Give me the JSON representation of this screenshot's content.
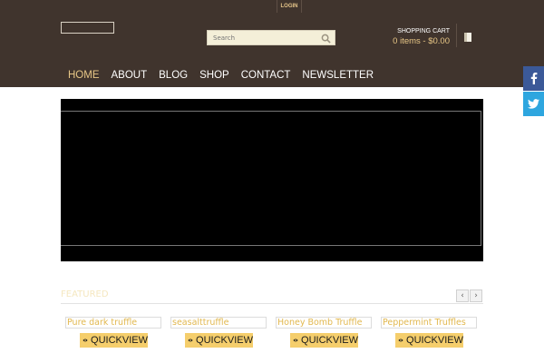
{
  "header": {
    "login": "LOGIN",
    "search": {
      "placeholder": "Search"
    },
    "cart": {
      "title": "SHOPPING CART",
      "summary": "0 items - $0.00"
    }
  },
  "nav": {
    "items": [
      {
        "label": "HOME",
        "active": true
      },
      {
        "label": "ABOUT"
      },
      {
        "label": "BLOG"
      },
      {
        "label": "SHOP"
      },
      {
        "label": "CONTACT"
      },
      {
        "label": "NEWSLETTER"
      }
    ]
  },
  "social": {
    "facebook_icon": "facebook-icon",
    "twitter_icon": "twitter-icon"
  },
  "featured": {
    "title": "FEATURED",
    "prev_label": "‹",
    "next_label": "›",
    "products": [
      {
        "name": "Pure dark truffle",
        "quickview": "QUICKVIEW"
      },
      {
        "name": "seasalttruffle",
        "quickview": "QUICKVIEW"
      },
      {
        "name": "Honey Bomb Truffle",
        "quickview": "QUICKVIEW"
      },
      {
        "name": "Peppermint Truffles",
        "quickview": "QUICKVIEW"
      }
    ]
  },
  "colors": {
    "header_bg": "#40342d",
    "accent": "#e7c686",
    "quickview_bg": "#f5ce6c",
    "facebook": "#3b5998",
    "twitter": "#2ea6df"
  }
}
